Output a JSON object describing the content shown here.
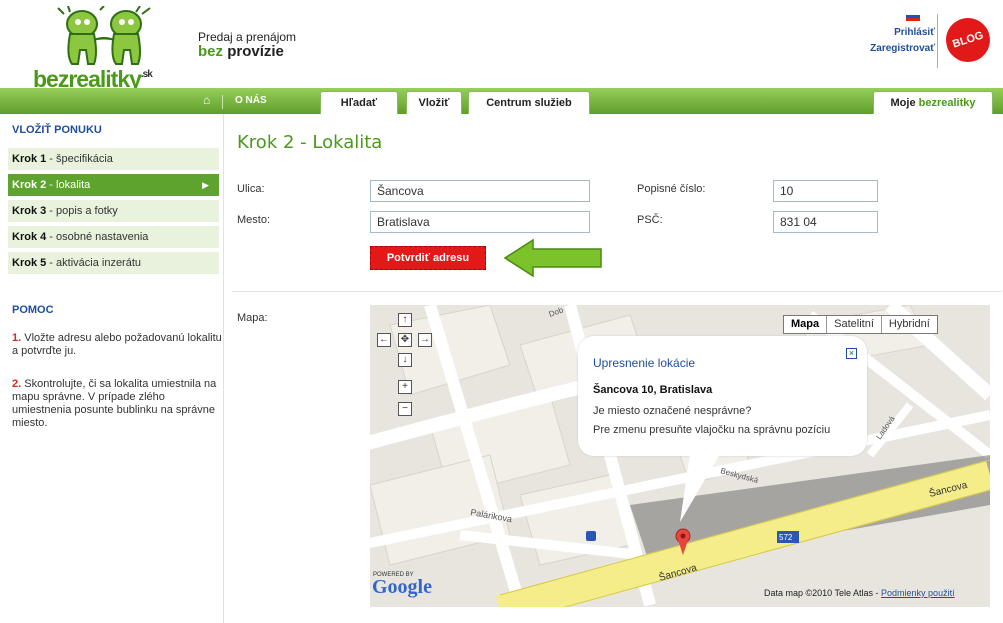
{
  "header": {
    "logo_text": "bezrealitky",
    "logo_suffix": ".sk",
    "tagline_top": "Predaj a prenájom",
    "tagline_bez": "bez",
    "tagline_provizie": "provízie",
    "login_label": "Prihlásiť",
    "register_label": "Zaregistrovať",
    "blog_label": "BLOG"
  },
  "nav": {
    "onas_label": "O NÁS",
    "tabs": [
      "Hľadať",
      "Vložiť",
      "Centrum služieb"
    ],
    "moje": "Moje",
    "moje_brand": "bezrealitky"
  },
  "sidebar": {
    "title": "VLOŽIŤ PONUKU",
    "steps": [
      {
        "num": "Krok 1",
        "text": " - špecifikácia"
      },
      {
        "num": "Krok 2",
        "text": " - lokalita",
        "active": true
      },
      {
        "num": "Krok 3",
        "text": " - popis a fotky"
      },
      {
        "num": "Krok 4",
        "text": " - osobné nastavenia"
      },
      {
        "num": "Krok 5",
        "text": " - aktivácia inzerátu"
      }
    ],
    "help_title": "POMOC",
    "help_items": [
      {
        "num": "1.",
        "text": " Vložte adresu alebo požadovanú lokalitu a potvrďte ju."
      },
      {
        "num": "2.",
        "text": " Skontrolujte, či sa lokalita umiestnila na mapu správne. V prípade zlého umiestnenia posunte bublinku na správne miesto."
      }
    ]
  },
  "main": {
    "title": "Krok 2 - Lokalita",
    "street_label": "Ulica:",
    "street_value": "Šancova",
    "number_label": "Popisné číslo:",
    "number_value": "10",
    "city_label": "Mesto:",
    "city_value": "Bratislava",
    "zip_label": "PSČ:",
    "zip_value": "831 04",
    "confirm_label": "Potvrdiť adresu",
    "map_label": "Mapa:"
  },
  "map": {
    "types": [
      "Mapa",
      "Satelitní",
      "Hybridní"
    ],
    "selected_type": "Mapa",
    "bubble_title": "Upresnenie lokácie",
    "bubble_address": "Šancova 10, Bratislava",
    "bubble_line1": "Je miesto označené nesprávne?",
    "bubble_line2": "Pre zmenu presuňte vlajočku na správnu pozíciu",
    "streets": [
      "Šancova",
      "Šancova",
      "Palárikova",
      "Beskydská",
      "Ladová",
      "Dob"
    ],
    "badge": "572",
    "powered_by": "POWERED BY",
    "google": "Google",
    "copyright": "Data map ©2010 Tele Atlas - ",
    "terms": "Podmienky použití"
  },
  "colors": {
    "brand_green": "#4a9a1a",
    "link_blue": "#1f4e9c",
    "red": "#e31919"
  }
}
